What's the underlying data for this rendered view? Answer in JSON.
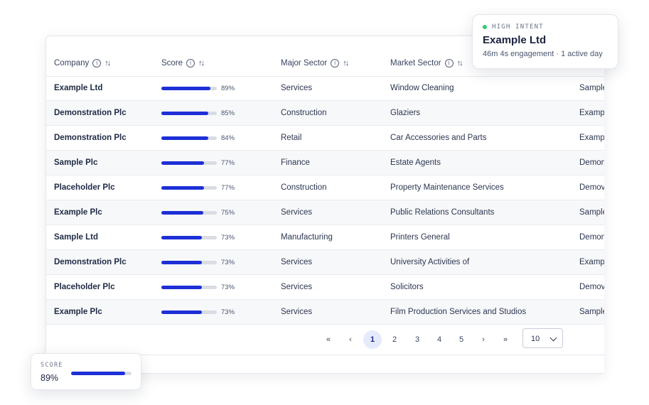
{
  "table": {
    "headers": {
      "company": "Company",
      "score": "Score",
      "major_sector": "Major Sector",
      "market_sector": "Market Sector"
    },
    "rows": [
      {
        "company": "Example Ltd",
        "score": 0.89,
        "score_label": "89%",
        "major": "Services",
        "market": "Window Cleaning",
        "extra": "Sample"
      },
      {
        "company": "Demonstration Plc",
        "score": 0.85,
        "score_label": "85%",
        "major": "Construction",
        "market": "Glaziers",
        "extra": "Exampl"
      },
      {
        "company": "Demonstration Plc",
        "score": 0.84,
        "score_label": "84%",
        "major": "Retail",
        "market": "Car Accessories and Parts",
        "extra": "Exampl"
      },
      {
        "company": "Sample Plc",
        "score": 0.77,
        "score_label": "77%",
        "major": "Finance",
        "market": "Estate Agents",
        "extra": "Demon"
      },
      {
        "company": "Placeholder Plc",
        "score": 0.77,
        "score_label": "77%",
        "major": "Construction",
        "market": "Property Maintenance Services",
        "extra": "Demovi"
      },
      {
        "company": "Example Plc",
        "score": 0.75,
        "score_label": "75%",
        "major": "Services",
        "market": "Public Relations Consultants",
        "extra": "Sample"
      },
      {
        "company": "Sample Ltd",
        "score": 0.73,
        "score_label": "73%",
        "major": "Manufacturing",
        "market": "Printers General",
        "extra": "Demon"
      },
      {
        "company": "Demonstration Plc",
        "score": 0.73,
        "score_label": "73%",
        "major": "Services",
        "market": "University Activities of",
        "extra": "Exampl"
      },
      {
        "company": "Placeholder Plc",
        "score": 0.73,
        "score_label": "73%",
        "major": "Services",
        "market": "Solicitors",
        "extra": "Demovi"
      },
      {
        "company": "Example Plc",
        "score": 0.73,
        "score_label": "73%",
        "major": "Services",
        "market": "Film Production Services and Studios",
        "extra": "Sample"
      }
    ]
  },
  "pagination": {
    "first": "«",
    "prev": "‹",
    "pages": [
      "1",
      "2",
      "3",
      "4",
      "5"
    ],
    "active_page": "1",
    "next": "›",
    "last": "»",
    "page_size": "10"
  },
  "intent_card": {
    "tag": "HIGH INTENT",
    "company": "Example Ltd",
    "meta": "46m 4s engagement · 1 active day",
    "status_color": "#2ecc71"
  },
  "score_card": {
    "label": "SCORE",
    "value": "89%",
    "score": 0.89
  },
  "colors": {
    "accent": "#1d2fd6",
    "track": "#d9dce3"
  }
}
